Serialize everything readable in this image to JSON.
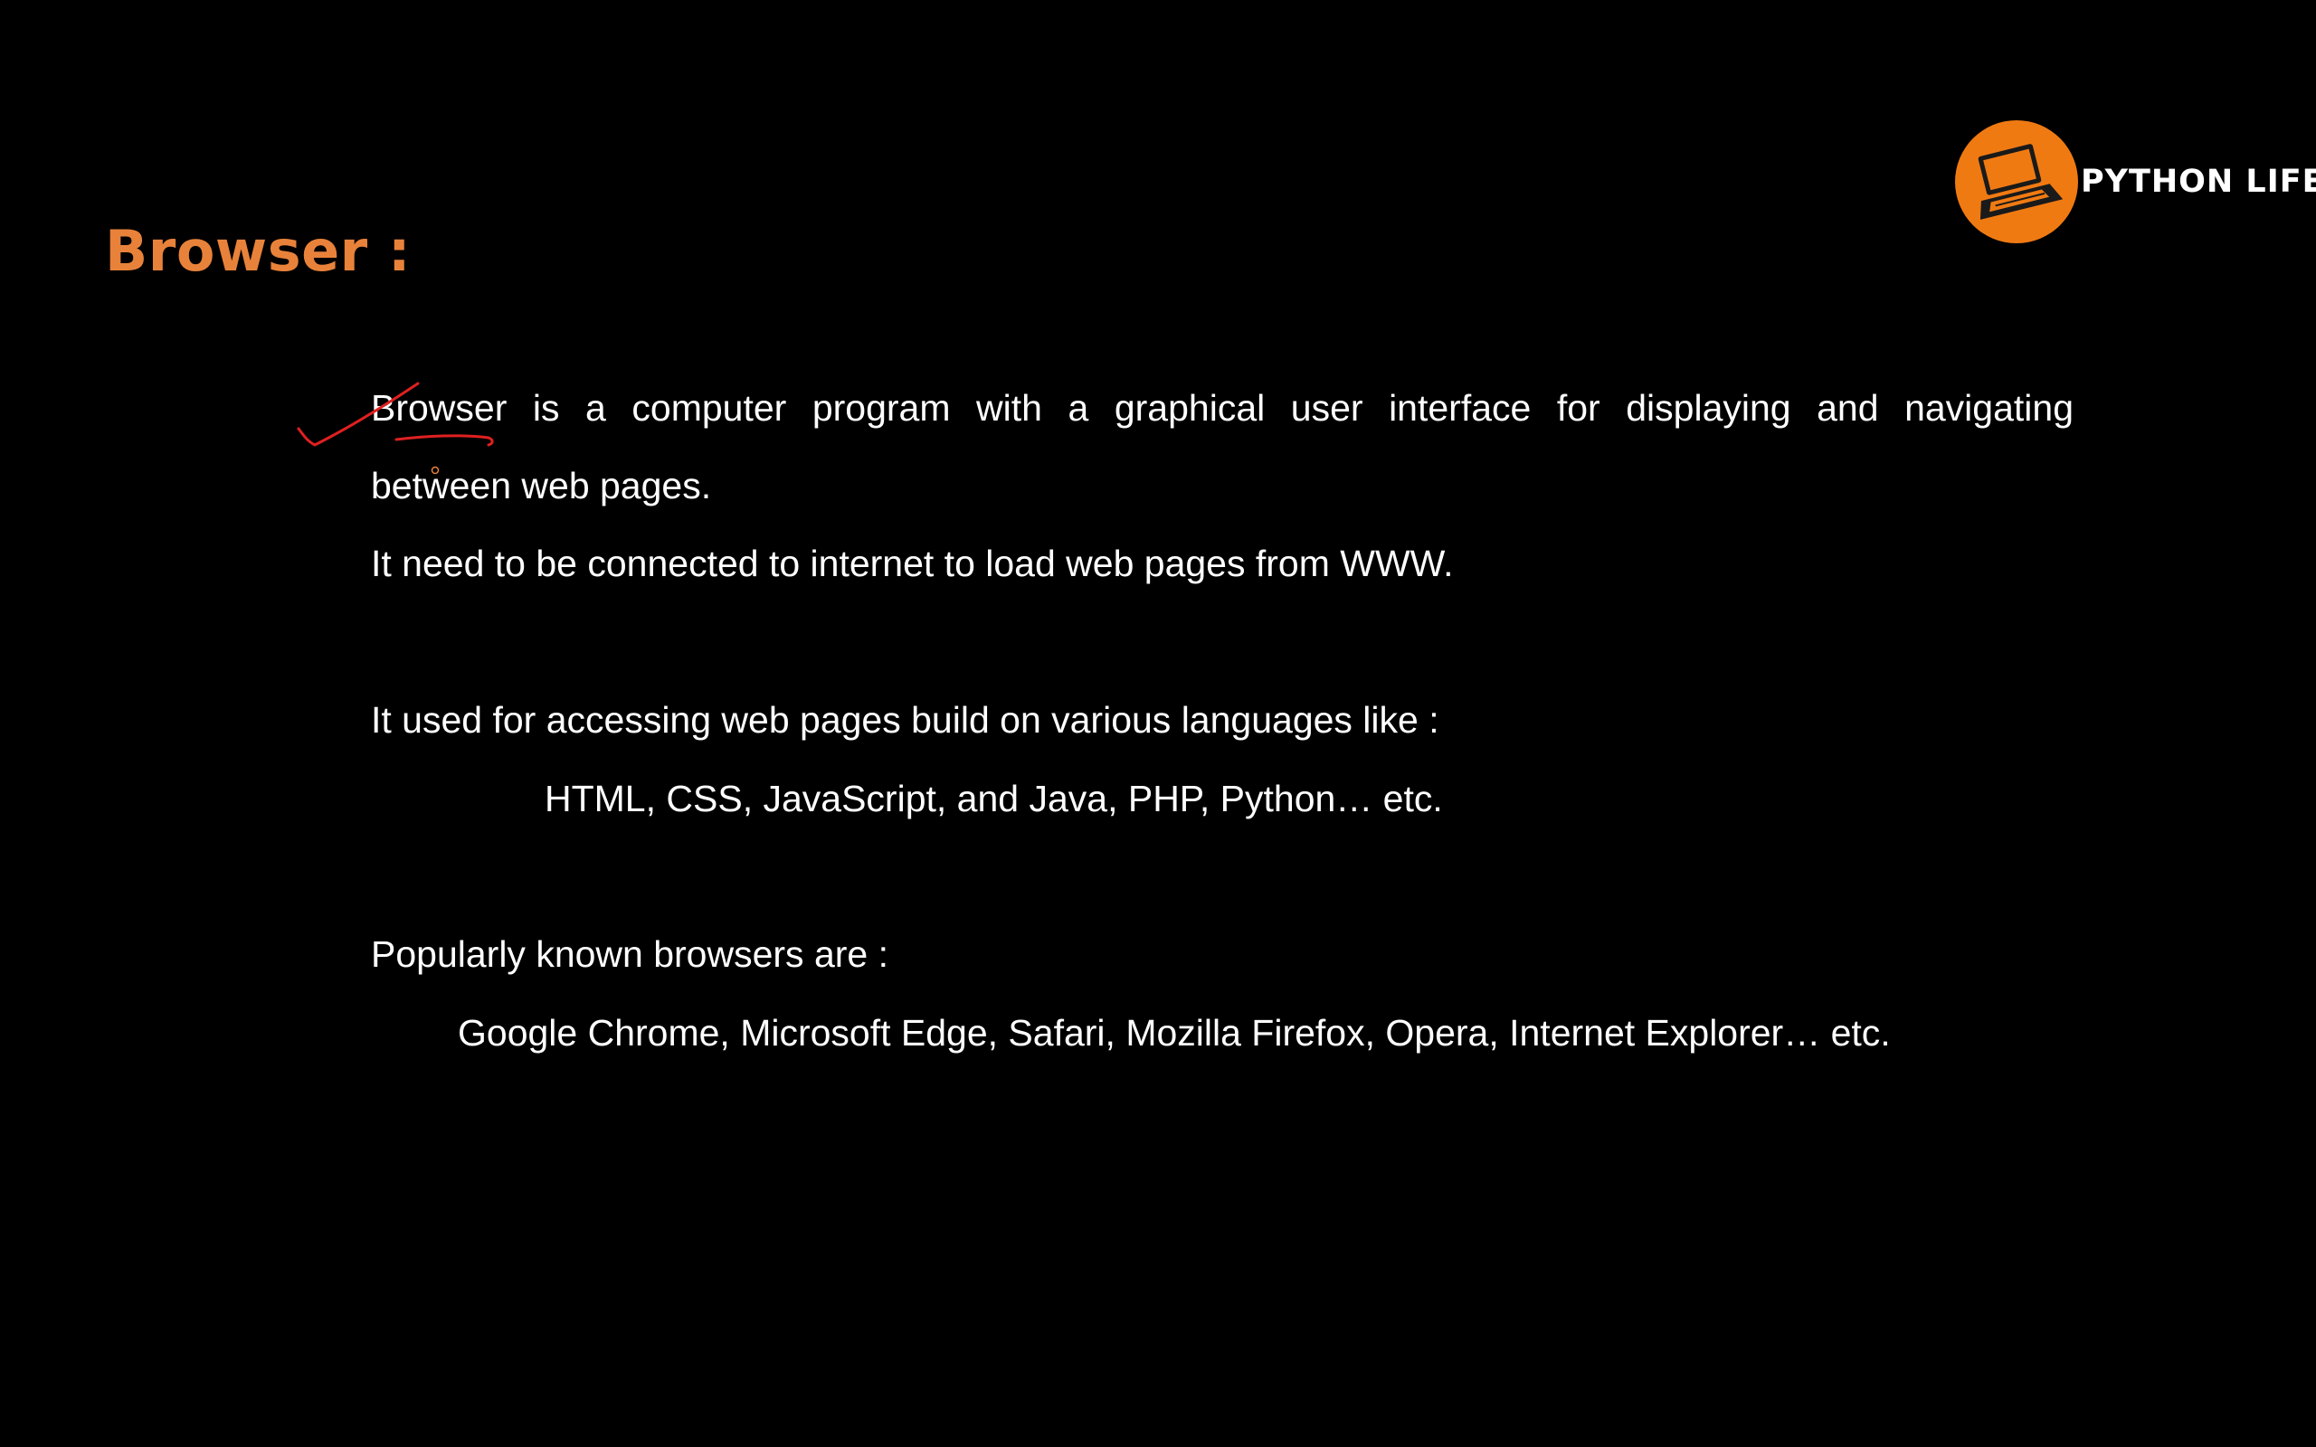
{
  "slide": {
    "title": "Browser :",
    "logo": {
      "text": "PYTHON LIFE",
      "icon": "laptop-icon",
      "accent": "#f07a12"
    },
    "paragraphs": {
      "definition_line1": "Browser is a computer program with a graphical user interface for displaying and navigating",
      "definition_line2": "between web pages.",
      "internet": "It need to be connected to internet to load web pages from WWW.",
      "languages_intro": "It used for accessing web pages build on various languages like :",
      "languages_list": "HTML, CSS, JavaScript, and Java, PHP, Python… etc.",
      "browsers_intro": "Popularly known browsers are :",
      "browsers_list": "Google Chrome, Microsoft Edge, Safari, Mozilla Firefox, Opera, Internet Explorer… etc."
    },
    "colors": {
      "background": "#000000",
      "title": "#e8823a",
      "text": "#ffffff",
      "annotation": "#e02020"
    }
  }
}
